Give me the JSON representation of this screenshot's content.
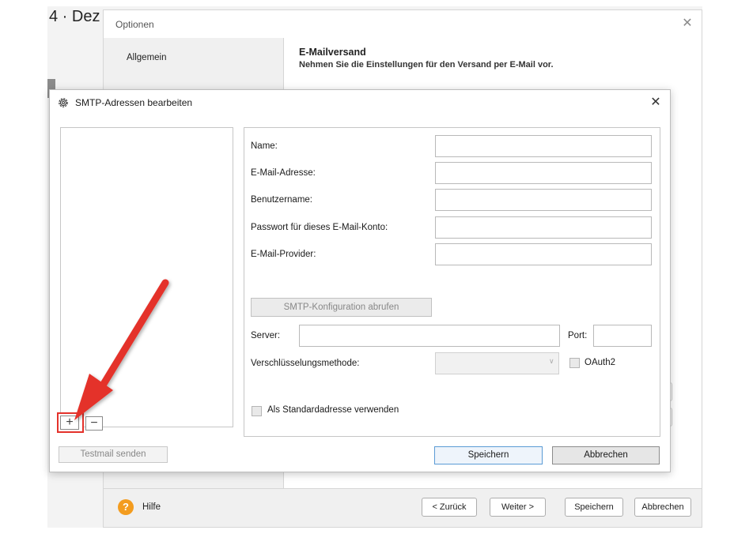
{
  "background_app": {
    "date_fragment": "4 · Dez"
  },
  "options_dialog": {
    "title": "Optionen",
    "close_glyph": "✕",
    "nav": {
      "items": [
        {
          "label": "Allgemein"
        }
      ]
    },
    "section": {
      "title": "E-Mailversand",
      "subtitle": "Nehmen Sie die Einstellungen für den Versand per E-Mail vor."
    },
    "footer": {
      "help_icon": "?",
      "help_label": "Hilfe",
      "back_label": "< Zurück",
      "next_label": "Weiter >",
      "save_label": "Speichern",
      "cancel_label": "Abbrechen"
    }
  },
  "smtp_dialog": {
    "title": "SMTP-Adressen bearbeiten",
    "icon": "gear-icon",
    "close_glyph": "✕",
    "list": {
      "items": []
    },
    "add_glyph": "+",
    "remove_glyph": "−",
    "testmail_label": "Testmail senden",
    "form": {
      "name_label": "Name:",
      "name_value": "",
      "email_label": "E-Mail-Adresse:",
      "email_value": "",
      "username_label": "Benutzername:",
      "username_value": "",
      "password_label": "Passwort für dieses E-Mail-Konto:",
      "password_value": "",
      "provider_label": "E-Mail-Provider:",
      "provider_value": "",
      "fetch_config_label": "SMTP-Konfiguration abrufen",
      "server_label": "Server:",
      "server_value": "",
      "port_label": "Port:",
      "port_value": "",
      "encryption_label": "Verschlüsselungsmethode:",
      "encryption_value": "",
      "oauth2_label": "OAuth2",
      "oauth2_checked": false,
      "default_label": "Als Standardadresse verwenden",
      "default_checked": false
    },
    "save_label": "Speichern",
    "cancel_label": "Abbrechen"
  },
  "annotation": {
    "arrow_color": "#e4322b",
    "highlight_color": "#e4322b"
  }
}
